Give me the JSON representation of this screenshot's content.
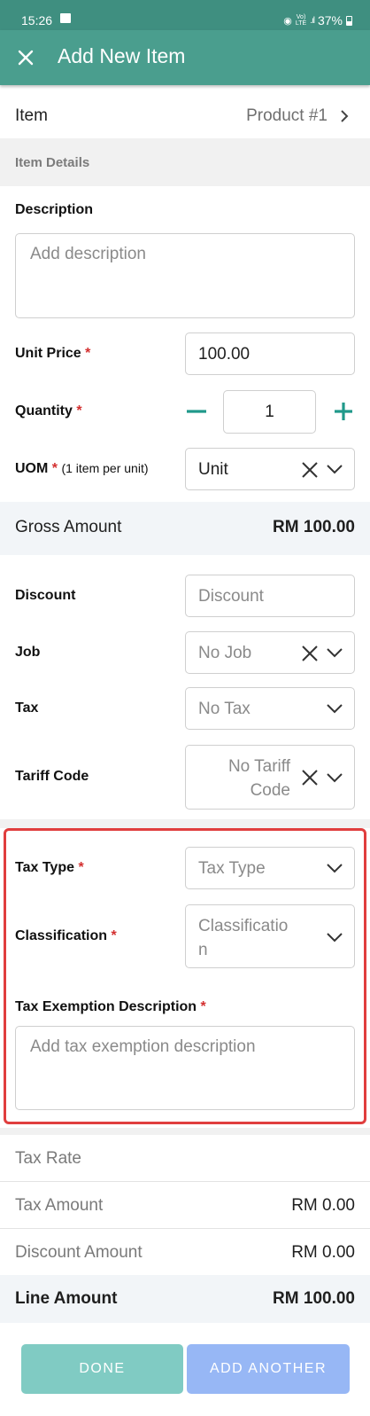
{
  "status_bar": {
    "time": "15:26",
    "battery": "37%",
    "lte": "Vo)\nLTE"
  },
  "header": {
    "title": "Add New Item"
  },
  "item_row": {
    "label": "Item",
    "value": "Product #1"
  },
  "section": {
    "title": "Item Details"
  },
  "description": {
    "label": "Description",
    "placeholder": "Add description"
  },
  "unit_price": {
    "label": "Unit Price",
    "required": "*",
    "value": "100.00"
  },
  "quantity": {
    "label": "Quantity",
    "required": "*",
    "value": "1"
  },
  "uom": {
    "label": "UOM",
    "required": "*",
    "note": "(1 item per unit)",
    "value": "Unit"
  },
  "gross": {
    "label": "Gross Amount",
    "value": "RM 100.00"
  },
  "discount": {
    "label": "Discount",
    "placeholder": "Discount"
  },
  "job": {
    "label": "Job",
    "placeholder": "No Job"
  },
  "tax": {
    "label": "Tax",
    "placeholder": "No Tax"
  },
  "tariff": {
    "label": "Tariff Code",
    "placeholder_line1": "No Tariff",
    "placeholder_line2": "Code"
  },
  "tax_type": {
    "label": "Tax Type",
    "required": "*",
    "placeholder": "Tax Type"
  },
  "classification": {
    "label": "Classification",
    "required": "*",
    "placeholder_line1": "Classificatio",
    "placeholder_line2": "n"
  },
  "tax_exemption": {
    "label": "Tax Exemption Description",
    "required": "*",
    "placeholder": "Add tax exemption description"
  },
  "summary": [
    {
      "label": "Tax Rate",
      "value": ""
    },
    {
      "label": "Tax Amount",
      "value": "RM 0.00"
    },
    {
      "label": "Discount Amount",
      "value": "RM 0.00"
    }
  ],
  "line_amount": {
    "label": "Line Amount",
    "value": "RM 100.00"
  },
  "buttons": {
    "done": "DONE",
    "add_another": "ADD ANOTHER"
  },
  "colors": {
    "header": "#4a9e8e",
    "status_bar": "#3f8f80",
    "accent": "#20998a",
    "required": "#d32f2f",
    "highlight_border": "#e03e3e",
    "done_button": "#80cbc3",
    "add_another_button": "#97b7f5"
  },
  "icons": [
    "gallery-icon",
    "wifi-icon",
    "signal-icon",
    "battery-icon",
    "close-icon",
    "chevron-right-icon",
    "minus-icon",
    "plus-icon",
    "clear-icon",
    "chevron-down-icon"
  ]
}
